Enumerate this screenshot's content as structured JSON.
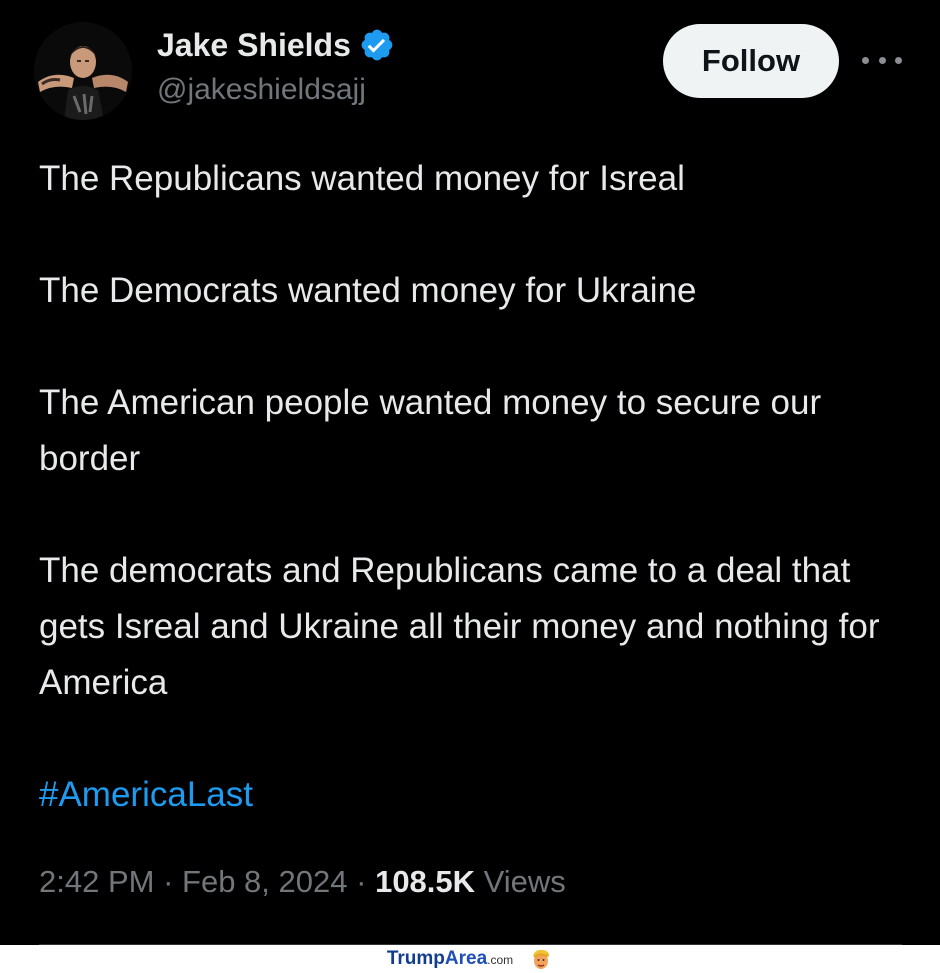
{
  "author": {
    "display_name": "Jake Shields",
    "handle": "@jakeshieldsajj",
    "verified": true
  },
  "actions": {
    "follow_label": "Follow"
  },
  "post": {
    "paragraphs": [
      "The Republicans wanted money for Isreal",
      "The Democrats wanted money for Ukraine",
      "The American people wanted money to secure our border",
      "The democrats and Republicans came to a deal that gets Isreal and Ukraine all their money and nothing for America"
    ],
    "hashtag": "#AmericaLast"
  },
  "meta": {
    "time": "2:42 PM",
    "separator": "·",
    "date": "Feb 8, 2024",
    "views_count": "108.5K",
    "views_label": "Views"
  },
  "watermark": {
    "brand_main": "Trump",
    "brand_accent": "Area",
    "brand_tld": ".com"
  },
  "colors": {
    "background": "#000000",
    "text": "#e7e9ea",
    "muted": "#71767b",
    "accent": "#1d9bf0",
    "follow_bg": "#eff3f4"
  }
}
